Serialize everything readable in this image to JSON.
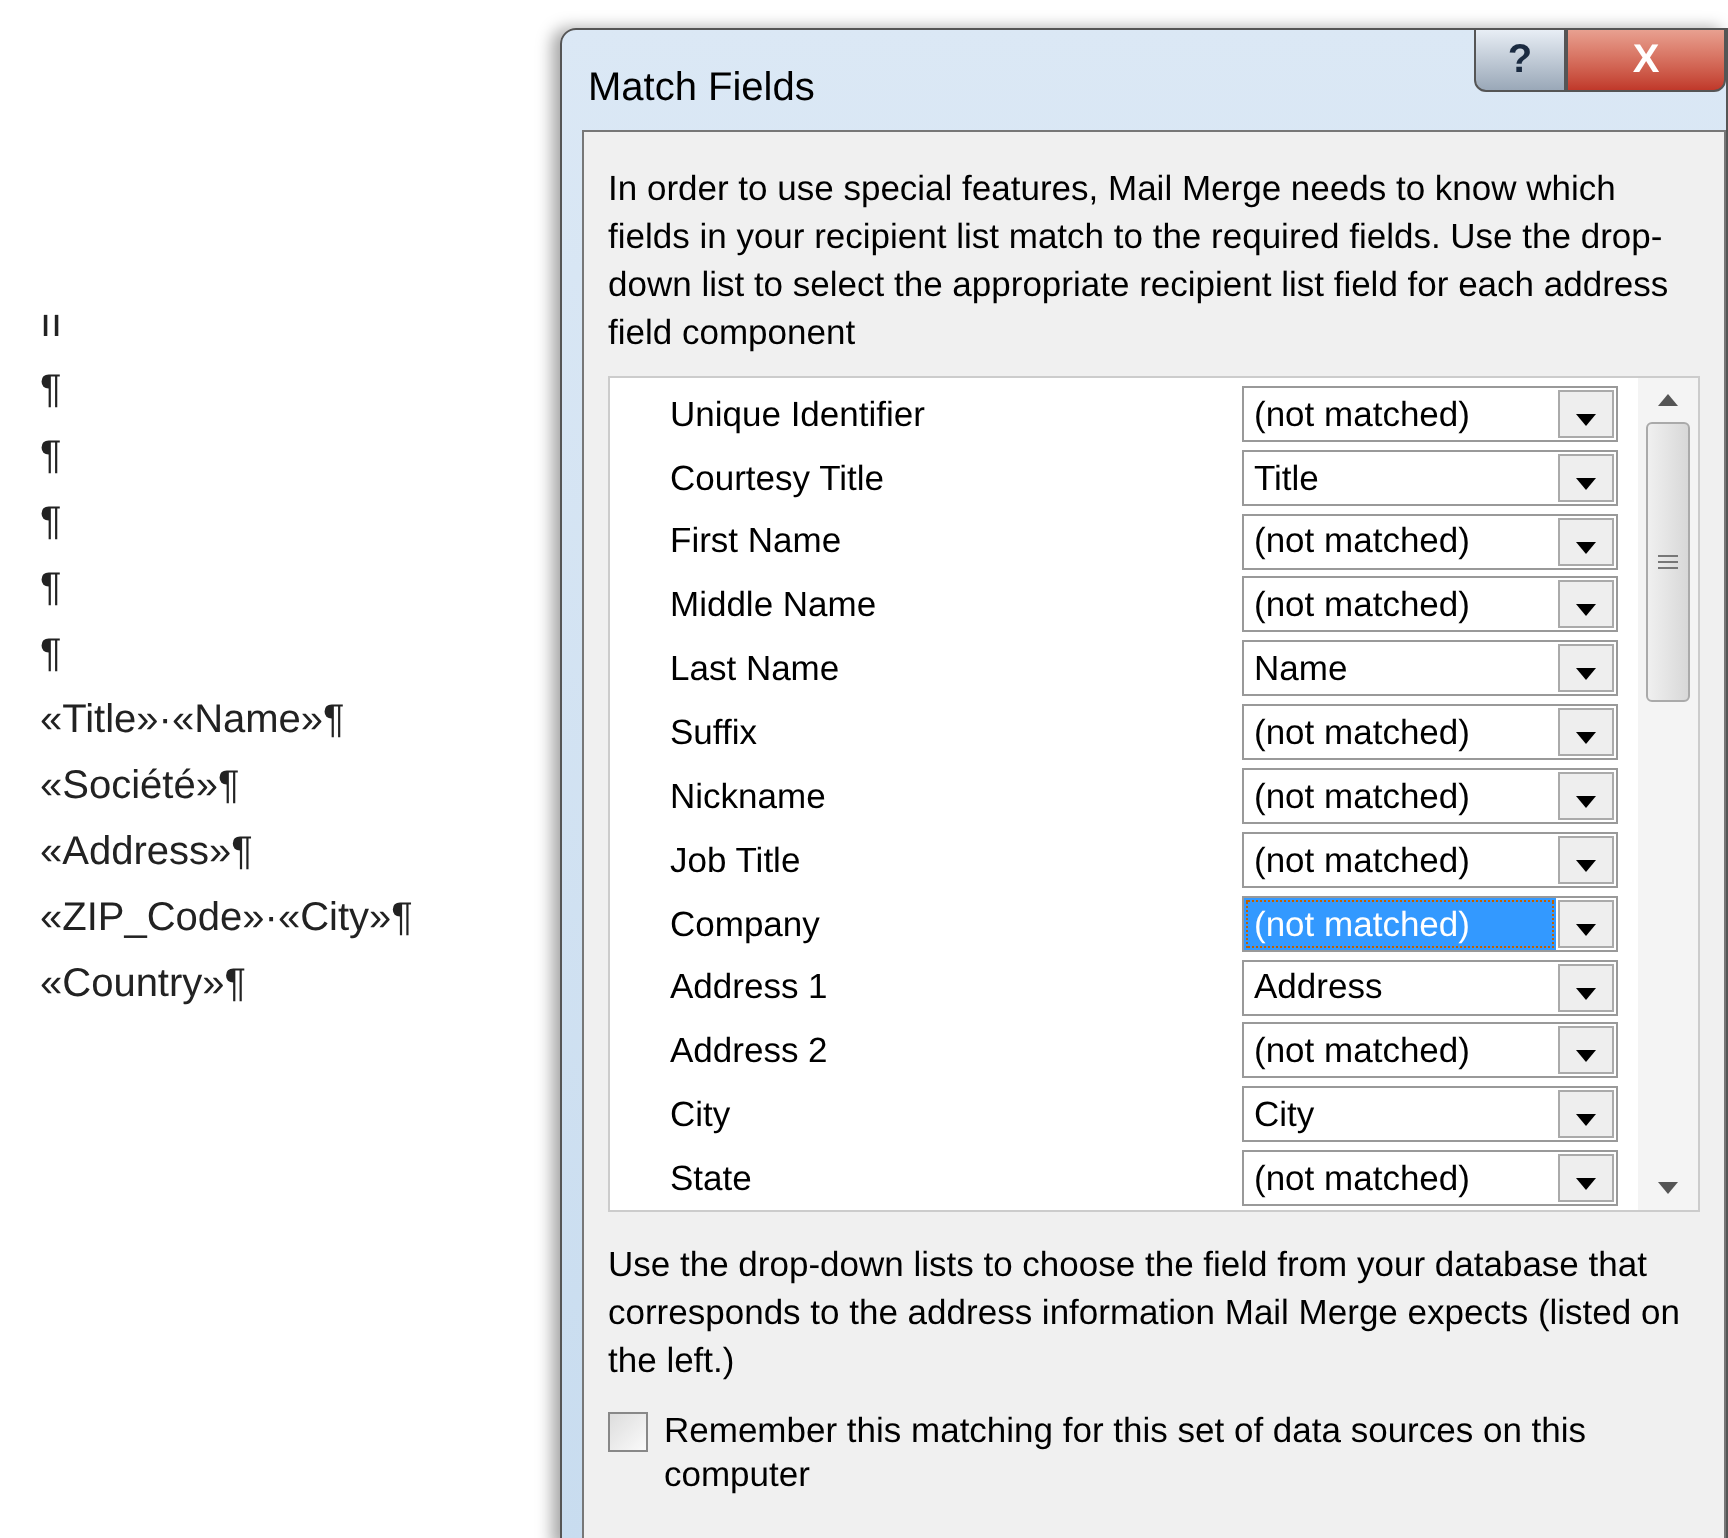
{
  "document": {
    "lines": [
      "ıı",
      "¶",
      "¶",
      "¶",
      "¶",
      "¶",
      "«Title»·«Name»¶",
      "«Société»¶",
      "«Address»¶",
      "«ZIP_Code»·«City»¶",
      "«Country»¶"
    ]
  },
  "dialog": {
    "title": "Match Fields",
    "help_button": "?",
    "close_button": "X",
    "description": "In order to use special features, Mail Merge needs to know which fields in your recipient list match to the required fields.  Use the drop-down list to select the appropriate recipient list field for each address field component",
    "fields": [
      {
        "label": "Unique Identifier",
        "value": "(not matched)",
        "selected": false
      },
      {
        "label": "Courtesy Title",
        "value": "Title",
        "selected": false
      },
      {
        "label": "First Name",
        "value": "(not matched)",
        "selected": false
      },
      {
        "label": "Middle Name",
        "value": "(not matched)",
        "selected": false
      },
      {
        "label": "Last Name",
        "value": "Name",
        "selected": false
      },
      {
        "label": "Suffix",
        "value": "(not matched)",
        "selected": false
      },
      {
        "label": "Nickname",
        "value": "(not matched)",
        "selected": false
      },
      {
        "label": "Job Title",
        "value": "(not matched)",
        "selected": false
      },
      {
        "label": "Company",
        "value": "(not matched)",
        "selected": true
      },
      {
        "label": "Address 1",
        "value": "Address",
        "selected": false
      },
      {
        "label": "Address 2",
        "value": "(not matched)",
        "selected": false
      },
      {
        "label": "City",
        "value": "City",
        "selected": false
      },
      {
        "label": "State",
        "value": "(not matched)",
        "selected": false
      }
    ],
    "hint": "Use the drop-down lists to choose the field from your database that corresponds to the address information Mail Merge expects (listed on the left.)",
    "remember": {
      "label": "Remember this matching for this set of data sources on this computer",
      "checked": false
    }
  }
}
